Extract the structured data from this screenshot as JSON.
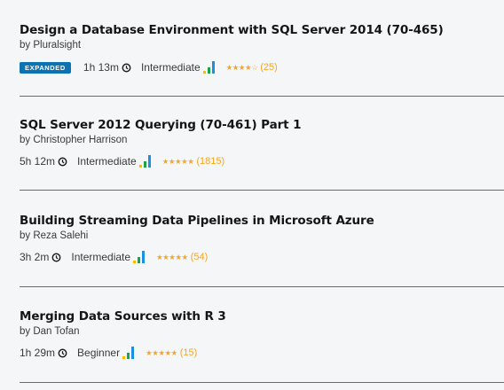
{
  "courses": [
    {
      "title": "Design a Database Environment with SQL Server 2014 (70-465)",
      "author": "by Pluralsight",
      "badge": "EXPANDED",
      "duration": "1h 13m",
      "level": "Intermediate",
      "level_icon": "intermediate-bars-icon",
      "stars": "★★★★☆",
      "rating_value": 4,
      "reviews": "(25)"
    },
    {
      "title": "SQL Server 2012 Querying (70-461) Part 1",
      "author": "by Christopher Harrison",
      "duration": "5h 12m",
      "level": "Intermediate",
      "level_icon": "intermediate-bars-icon",
      "stars": "★★★★★",
      "rating_value": 4.5,
      "reviews": "(1815)"
    },
    {
      "title": "Building Streaming Data Pipelines in Microsoft Azure",
      "author": "by Reza Salehi",
      "duration": "3h 2m",
      "level": "Intermediate",
      "level_icon": "intermediate-bars-icon",
      "stars": "★★★★★",
      "rating_value": 4.5,
      "reviews": "(54)"
    },
    {
      "title": "Merging Data Sources with R 3",
      "author": "by Dan Tofan",
      "duration": "1h 29m",
      "level": "Beginner",
      "level_icon": "beginner-bars-icon",
      "stars": "★★★★★",
      "rating_value": 5,
      "reviews": "(15)"
    }
  ],
  "colors": {
    "badge": "#0b73b4",
    "star": "#f5a623",
    "bar_yellow": "#ffb700",
    "bar_green": "#1ba34a",
    "bar_blue": "#1b8fe0",
    "background": "#f5f6f8"
  }
}
